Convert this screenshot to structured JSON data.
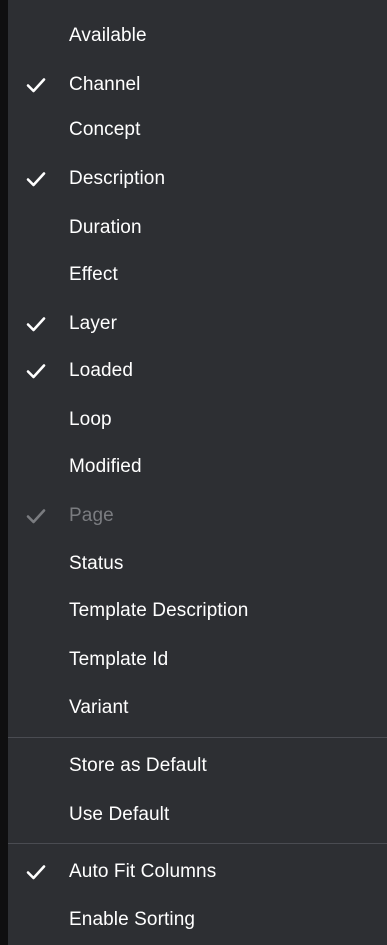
{
  "menu": {
    "columns": [
      {
        "label": "Available",
        "checked": false,
        "disabled": false
      },
      {
        "label": "Channel",
        "checked": true,
        "disabled": false
      },
      {
        "label": "Concept",
        "checked": false,
        "disabled": false
      },
      {
        "label": "Description",
        "checked": true,
        "disabled": false
      },
      {
        "label": "Duration",
        "checked": false,
        "disabled": false
      },
      {
        "label": "Effect",
        "checked": false,
        "disabled": false
      },
      {
        "label": "Layer",
        "checked": true,
        "disabled": false
      },
      {
        "label": "Loaded",
        "checked": true,
        "disabled": false
      },
      {
        "label": "Loop",
        "checked": false,
        "disabled": false
      },
      {
        "label": "Modified",
        "checked": false,
        "disabled": false
      },
      {
        "label": "Page",
        "checked": true,
        "disabled": true
      },
      {
        "label": "Status",
        "checked": false,
        "disabled": false
      },
      {
        "label": "Template Description",
        "checked": false,
        "disabled": false
      },
      {
        "label": "Template Id",
        "checked": false,
        "disabled": false
      },
      {
        "label": "Variant",
        "checked": false,
        "disabled": false
      }
    ],
    "defaults": [
      {
        "label": "Store as Default",
        "checked": false,
        "disabled": false
      },
      {
        "label": "Use Default",
        "checked": false,
        "disabled": false
      }
    ],
    "options": [
      {
        "label": "Auto Fit Columns",
        "checked": true,
        "disabled": false
      },
      {
        "label": "Enable Sorting",
        "checked": false,
        "disabled": false
      }
    ],
    "colors": {
      "background": "#2d2f33",
      "text": "#ffffff",
      "disabled_text": "#7a7c80",
      "separator": "#4a4c52"
    }
  }
}
